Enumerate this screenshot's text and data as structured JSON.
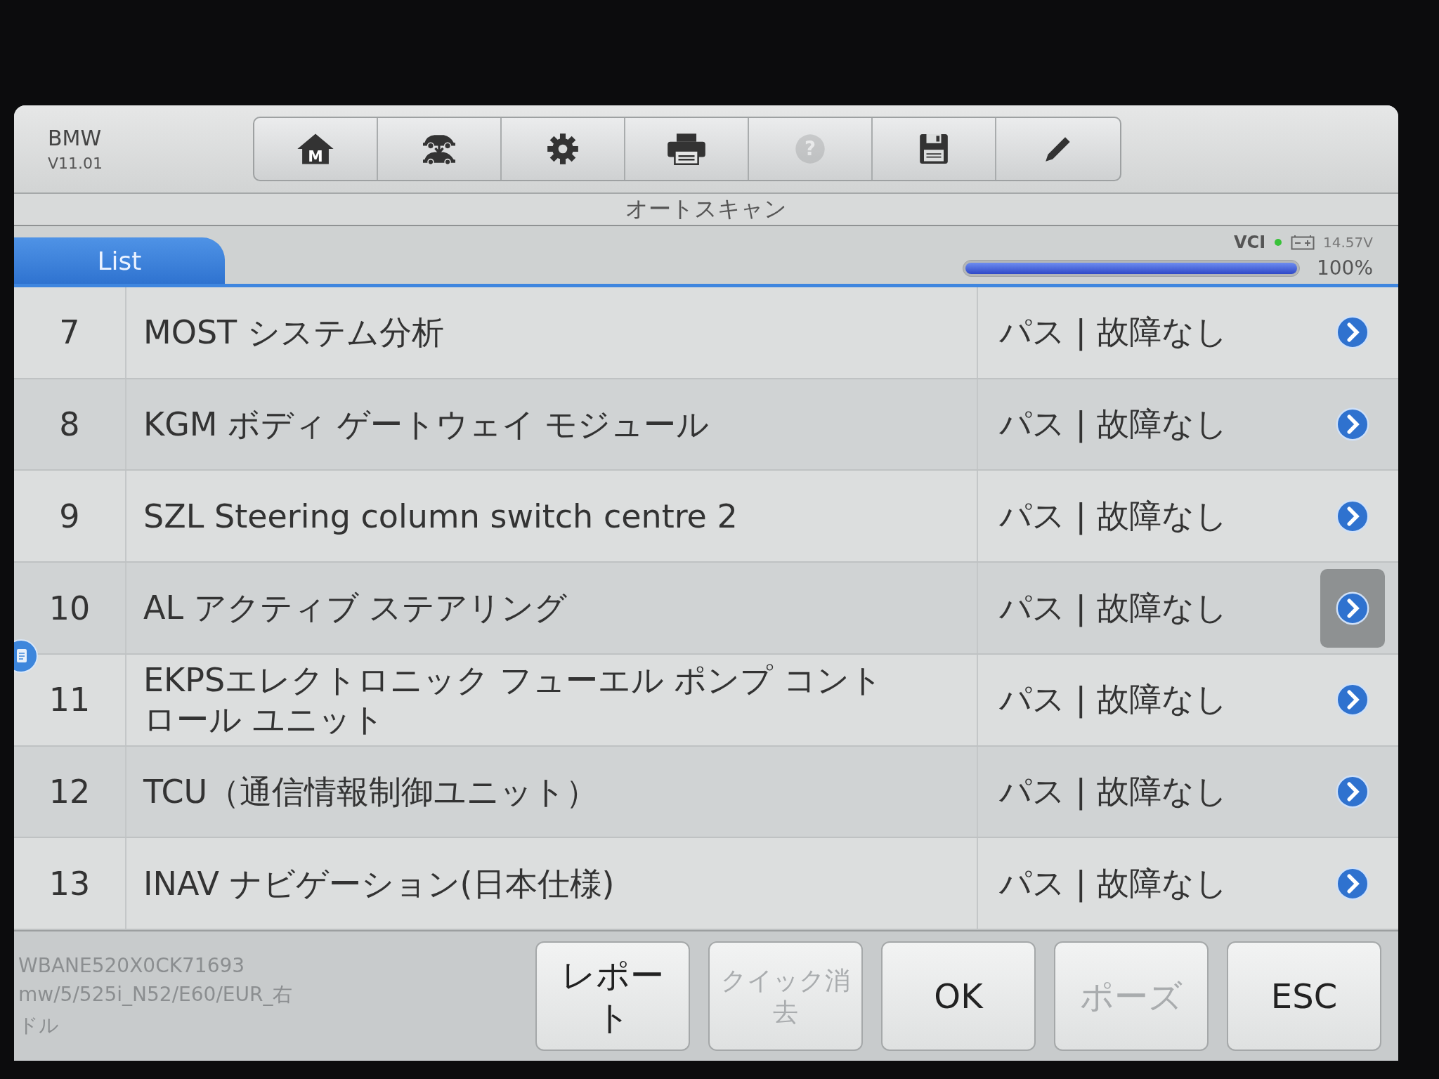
{
  "header": {
    "brand": "BMW",
    "version": "V11.01"
  },
  "toolbar": [
    {
      "kind": "home",
      "glyph": "M",
      "disabled": false
    },
    {
      "kind": "vehicle-swap",
      "disabled": false
    },
    {
      "kind": "settings",
      "disabled": false
    },
    {
      "kind": "print",
      "disabled": false
    },
    {
      "kind": "help",
      "glyph": "?",
      "disabled": true
    },
    {
      "kind": "save",
      "disabled": false
    },
    {
      "kind": "edit",
      "disabled": false
    }
  ],
  "title": "オートスキャン",
  "tabs": [
    {
      "label": "List",
      "selected": true
    }
  ],
  "status": {
    "vci": "VCI",
    "voltage": "14.57V",
    "progress": {
      "level": 1,
      "reading": "100%"
    }
  },
  "rows": [
    {
      "number": "7",
      "name": "MOST システム分析",
      "result": "パス | 故障なし",
      "selected": false
    },
    {
      "number": "8",
      "name": "KGM ボディ ゲートウェイ モジュール",
      "result": "パス | 故障なし",
      "selected": false
    },
    {
      "number": "9",
      "name": "SZL Steering column switch centre 2",
      "result": "パス | 故障なし",
      "selected": false
    },
    {
      "number": "10",
      "name": "AL アクティブ ステアリング",
      "result": "パス | 故障なし",
      "selected": true
    },
    {
      "number": "11",
      "name": "EKPSエレクトロニック フューエル ポンプ コントロール ユニット",
      "result": "パス | 故障なし",
      "selected": false
    },
    {
      "number": "12",
      "name": "TCU（通信情報制御ユニット）",
      "result": "パス | 故障なし",
      "selected": false
    },
    {
      "number": "13",
      "name": "INAV ナビゲーション(日本仕様)",
      "result": "パス | 故障なし",
      "selected": false
    }
  ],
  "footer": {
    "vehicle_info": [
      "WBANE520X0CK71693",
      "mw/5/525i_N52/E60/EUR_右",
      "ドル"
    ],
    "buttons": [
      {
        "label": "レポート",
        "disabled": false
      },
      {
        "label": "クイック消去",
        "disabled": true
      },
      {
        "label": "OK",
        "disabled": false
      },
      {
        "label": "ポーズ",
        "disabled": true
      },
      {
        "label": "ESC",
        "disabled": false
      }
    ]
  }
}
